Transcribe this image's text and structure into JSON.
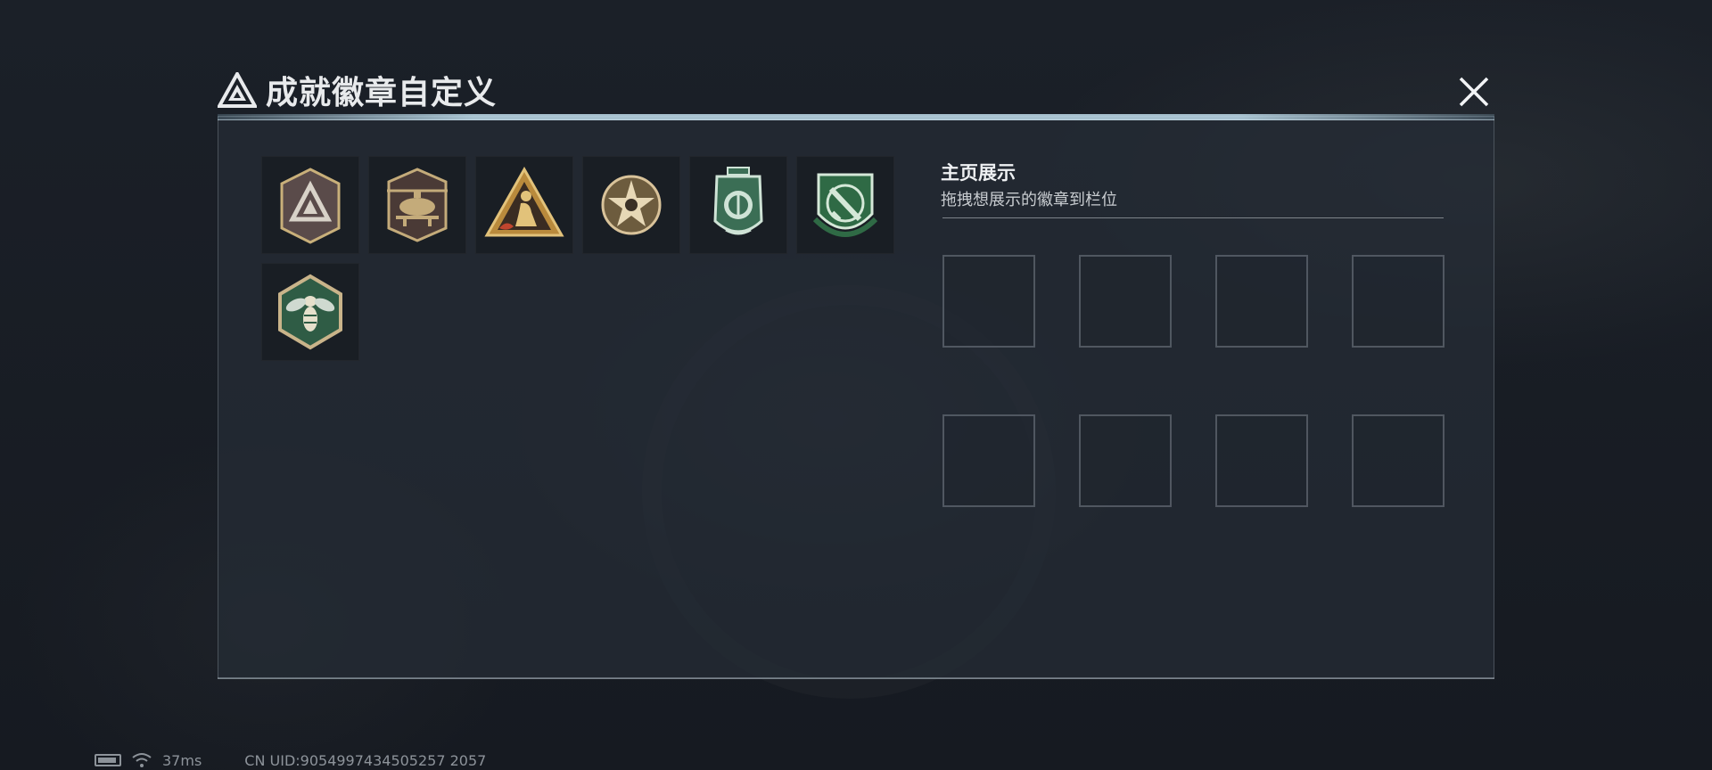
{
  "header": {
    "title": "成就徽章自定义",
    "logo_icon": "triangle-logo-icon",
    "close_icon": "close-icon"
  },
  "badges": [
    {
      "name": "triangle-shield-badge",
      "icon": "triangle-shield-badge-icon",
      "colors": {
        "base": "#5a4b4a",
        "trim": "#c9b07a"
      }
    },
    {
      "name": "helicopter-badge",
      "icon": "helicopter-badge-icon",
      "colors": {
        "base": "#4a3a36",
        "trim": "#c4ab7a"
      }
    },
    {
      "name": "triangle-figure-badge",
      "icon": "triangle-figure-badge-icon",
      "colors": {
        "base": "#b98a3c",
        "trim": "#e2c27a"
      }
    },
    {
      "name": "star-medal-badge",
      "icon": "star-medal-badge-icon",
      "colors": {
        "base": "#6d5c3e",
        "trim": "#d9c39a"
      }
    },
    {
      "name": "green-shield-badge",
      "icon": "green-shield-badge-icon",
      "colors": {
        "base": "#3b6e55",
        "trim": "#cfe3d6"
      }
    },
    {
      "name": "dagger-crest-badge",
      "icon": "dagger-crest-badge-icon",
      "colors": {
        "base": "#2f6a45",
        "trim": "#d5e8d8"
      }
    },
    {
      "name": "wasp-hexagon-badge",
      "icon": "wasp-hexagon-badge-icon",
      "colors": {
        "base": "#2f5c45",
        "trim": "#c9b48a"
      }
    }
  ],
  "display": {
    "title": "主页展示",
    "subtitle": "拖拽想展示的徽章到栏位",
    "slots": [
      {},
      {},
      {},
      {},
      {},
      {},
      {},
      {}
    ]
  },
  "status_bar": {
    "battery_icon": "battery-icon",
    "wifi_icon": "wifi-icon",
    "latency": "37ms",
    "uid": "CN UID:9054997434505257 2057"
  },
  "colors": {
    "accent_line": "#bcdcea",
    "panel_bg": "#262c36",
    "slot_border": "#78808a"
  }
}
